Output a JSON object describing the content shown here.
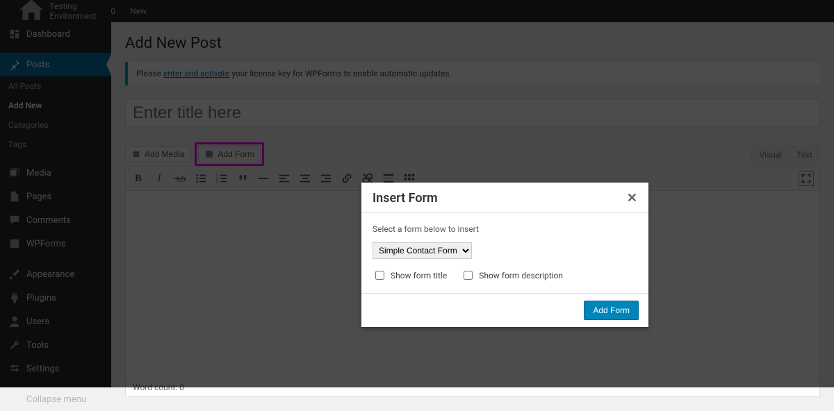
{
  "adminbar": {
    "site_name": "Testing Environment",
    "comments_count": "0",
    "new_label": "New"
  },
  "sidebar": {
    "dashboard": "Dashboard",
    "posts": "Posts",
    "posts_sub": {
      "all": "All Posts",
      "add_new": "Add New",
      "categories": "Categories",
      "tags": "Tags"
    },
    "media": "Media",
    "pages": "Pages",
    "comments": "Comments",
    "wpforms": "WPForms",
    "appearance": "Appearance",
    "plugins": "Plugins",
    "users": "Users",
    "tools": "Tools",
    "settings": "Settings",
    "collapse": "Collapse menu"
  },
  "page": {
    "heading": "Add New Post",
    "notice_prefix": "Please ",
    "notice_link": "enter and activate",
    "notice_suffix": " your license key for WPForms to enable automatic updates.",
    "title_placeholder": "Enter title here",
    "add_media": "Add Media",
    "add_form": "Add Form",
    "tab_visual": "Visual",
    "tab_text": "Text",
    "word_count": "Word count: 0"
  },
  "modal": {
    "title": "Insert Form",
    "instruction": "Select a form below to insert",
    "selected_form": "Simple Contact Form",
    "show_title": "Show form title",
    "show_description": "Show form description",
    "submit": "Add Form"
  }
}
